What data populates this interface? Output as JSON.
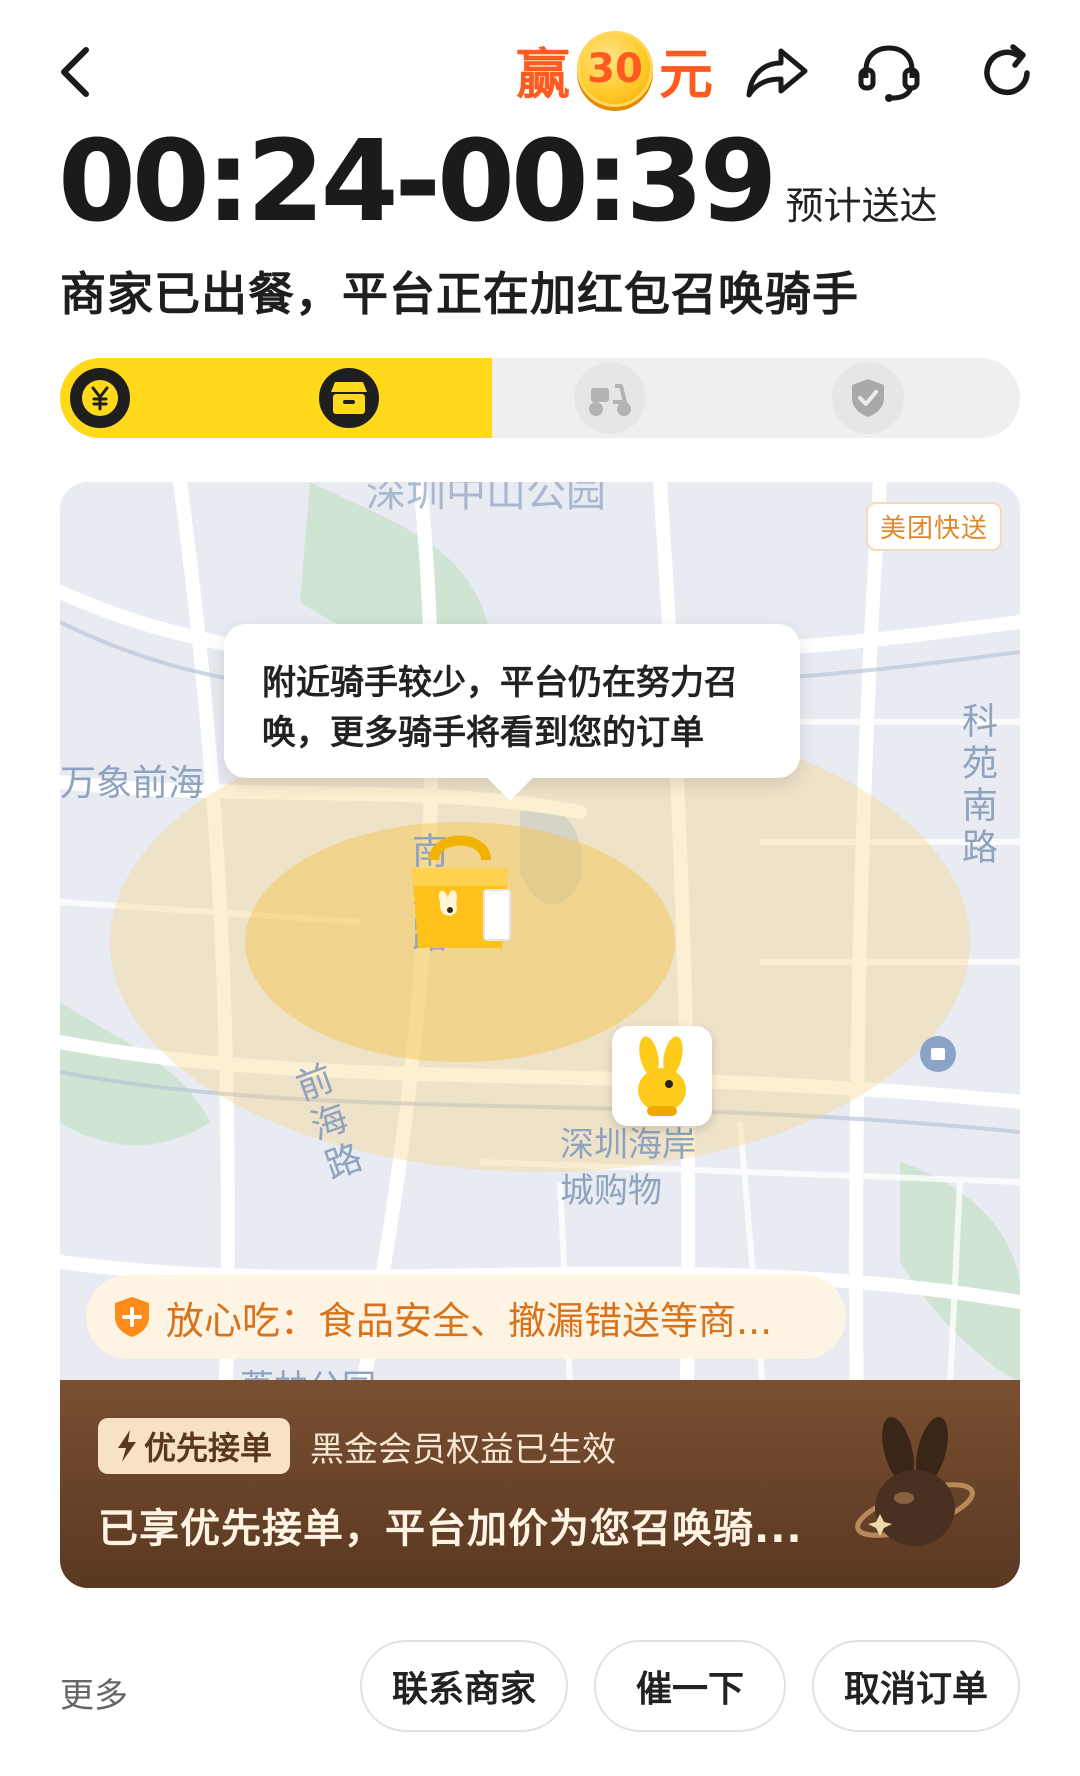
{
  "header": {
    "promo": {
      "prefix": "赢",
      "amount": "30",
      "suffix": "元"
    },
    "icons": [
      "back-icon",
      "share-icon",
      "customer-service-icon",
      "refresh-icon"
    ]
  },
  "eta": {
    "time": "00:24-00:39",
    "suffix": "预计送达"
  },
  "status": "商家已出餐，平台正在加红包召唤骑手",
  "progress": {
    "steps": [
      {
        "icon": "yuan-icon",
        "state": "done"
      },
      {
        "icon": "store-icon",
        "state": "done"
      },
      {
        "icon": "scooter-icon",
        "state": "pending"
      },
      {
        "icon": "check-icon",
        "state": "pending"
      }
    ],
    "fill_fraction": 0.45
  },
  "map": {
    "brand_tag": "美团快送",
    "tooltip": "附近骑手较少，平台仍在努力召唤，更多骑手将看到您的订单",
    "labels": {
      "top": "深圳中山公园",
      "left": "万象前海",
      "right_road": "科苑南路",
      "center_road": "南新路",
      "lower_road": "前海路",
      "mall": "深圳海岸城购物",
      "bottom": "荔林公园"
    }
  },
  "safety_banner": "放心吃：食品安全、撤漏错送等商...",
  "member": {
    "badge": "优先接单",
    "subtitle": "黑金会员权益已生效",
    "message": "已享优先接单，平台加价为您召唤骑..."
  },
  "actions": {
    "more": "更多",
    "contact": "联系商家",
    "urge": "催一下",
    "cancel": "取消订单"
  },
  "colors": {
    "accent_yellow": "#ffd91a",
    "promo_orange": "#ff5a1f",
    "member_brown": "#6b4329",
    "safety_orange": "#d9721a"
  }
}
